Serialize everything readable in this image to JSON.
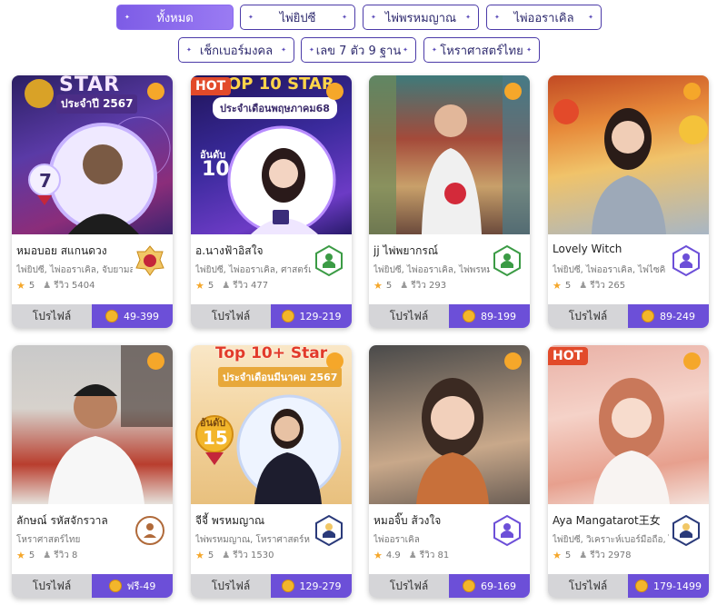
{
  "filters": {
    "row1": [
      "ทั้งหมด",
      "ไพ่ยิปซี",
      "ไพ่พรหมญาณ",
      "ไพ่ออราเคิล"
    ],
    "row2": [
      "เช็กเบอร์มงคล",
      "เลข 7 ตัว 9 ฐาน",
      "โหราศาสตร์ไทย"
    ],
    "active": "ทั้งหมด"
  },
  "profile_label": "โปรไฟล์",
  "cards": [
    {
      "name": "หมอบอย สแกนดวง",
      "categories": "ไพ่ยิปซี, ไพ่ออราเคิล, จับยามส",
      "rating": "5",
      "reviews": "รีวิว 5404",
      "price": "49-399",
      "hot": "",
      "overlay_title": "STAR",
      "overlay_sub": "ประจำปี 2567",
      "overlay_rank": "7"
    },
    {
      "name": "อ.นางฟ้าอิสใจ",
      "categories": "ไพ่ยิปซี, ไพ่ออราเคิล, ศาสตร์เ",
      "rating": "5",
      "reviews": "รีวิว 477",
      "price": "129-219",
      "hot": "HOT",
      "overlay_title": "OP 10 STAR",
      "overlay_sub": "ประจำเดือนพฤษภาคม68",
      "overlay_rank_label": "อันดับ",
      "overlay_rank": "10"
    },
    {
      "name": "jj ไพ่พยากรณ์",
      "categories": "ไพ่ยิปซี, ไพ่ออราเคิล, ไพ่พรหม",
      "rating": "5",
      "reviews": "รีวิว 293",
      "price": "89-199",
      "hot": ""
    },
    {
      "name": "Lovely Witch",
      "categories": "ไพ่ยิปซี, ไพ่ออราเคิล, ไพ่ไซคิ",
      "rating": "5",
      "reviews": "รีวิว 265",
      "price": "89-249",
      "hot": ""
    },
    {
      "name": "ลักษณ์ รหัสจักรวาล",
      "categories": "โหราศาสตร์ไทย",
      "rating": "5",
      "reviews": "รีวิว 8",
      "price": "ฟรี-49",
      "hot": ""
    },
    {
      "name": "จีจี้ พรหมญาณ",
      "categories": "ไพ่พรหมญาณ, โหราศาสตร์ห",
      "rating": "5",
      "reviews": "รีวิว 1530",
      "price": "129-279",
      "hot": "",
      "overlay_title": "Top 10+ Star",
      "overlay_sub": "ประจำเดือนมีนาคม 2567",
      "overlay_rank_label": "อันดับ",
      "overlay_rank": "15"
    },
    {
      "name": "หมอจิ๊บ ส้วงใจ",
      "categories": "ไพ่ออราเคิล",
      "rating": "4.9",
      "reviews": "รีวิว 81",
      "price": "69-169",
      "hot": ""
    },
    {
      "name": "Aya Mangatarot王女",
      "categories": "ไพ่ยิปซี, วิเคราะห์เบอร์มือถือ, ไ",
      "rating": "5",
      "reviews": "รีวิว 2978",
      "price": "179-1499",
      "hot": "HOT"
    }
  ]
}
